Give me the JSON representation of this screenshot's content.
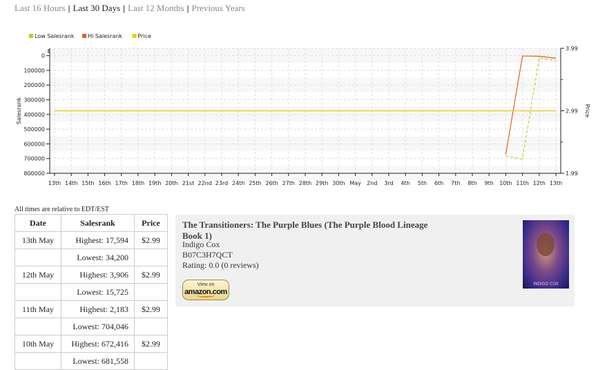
{
  "nav": {
    "items": [
      {
        "label": "Last 16 Hours",
        "active": false
      },
      {
        "label": "Last 30 Days",
        "active": true
      },
      {
        "label": "Last 12 Months",
        "active": false
      },
      {
        "label": "Previous Years",
        "active": false
      }
    ],
    "separator": "|"
  },
  "chart_data": {
    "type": "line",
    "legend_position": "top-left",
    "grid": true,
    "x_labels": [
      "13th",
      "14th",
      "15th",
      "16th",
      "17th",
      "18th",
      "19th",
      "20th",
      "21st",
      "22nd",
      "23rd",
      "24th",
      "25th",
      "26th",
      "27th",
      "28th",
      "29th",
      "30th",
      "May",
      "2nd",
      "3rd",
      "4th",
      "5th",
      "6th",
      "7th",
      "8th",
      "9th",
      "10th",
      "11th",
      "12th",
      "13th"
    ],
    "y_left": {
      "label": "Salesrank",
      "ticks": [
        0,
        100000,
        200000,
        300000,
        400000,
        500000,
        600000,
        700000,
        800000
      ],
      "tick_labels": [
        "0",
        "100000",
        "200000",
        "300000",
        "400000",
        "500000",
        "600000",
        "700000",
        "800000"
      ],
      "range": [
        800000,
        -50000
      ],
      "inverted": true
    },
    "y_right": {
      "label": "Price",
      "ticks": [
        1.99,
        2.99,
        3.99
      ],
      "tick_labels": [
        "1.99",
        "2.99",
        "3.99"
      ],
      "range": [
        1.99,
        3.99
      ]
    },
    "series": [
      {
        "name": "Low Salesrank",
        "axis": "left",
        "color": "#b8d020",
        "dashed": true,
        "points": [
          [
            27,
            681558
          ],
          [
            28,
            704046
          ],
          [
            29,
            15725
          ],
          [
            30,
            34200
          ]
        ]
      },
      {
        "name": "Hi Salesrank",
        "axis": "left",
        "color": "#e06020",
        "dashed": false,
        "points": [
          [
            27,
            672416
          ],
          [
            28,
            2183
          ],
          [
            29,
            3906
          ],
          [
            30,
            17594
          ]
        ]
      },
      {
        "name": "Price",
        "axis": "right",
        "color": "#e8d000",
        "dashed": false,
        "points": [
          [
            0,
            2.99
          ],
          [
            30,
            2.99
          ]
        ]
      }
    ]
  },
  "timezone_note": "All times are relative to EDT/EST",
  "table": {
    "headers": [
      "Date",
      "Salesrank",
      "Price"
    ],
    "rows": [
      {
        "date": "13th May",
        "rank": "Highest: 17,594",
        "price": "$2.99"
      },
      {
        "date": "",
        "rank": "Lowest: 34,200",
        "price": ""
      },
      {
        "date": "12th May",
        "rank": "Highest: 3,906",
        "price": "$2.99"
      },
      {
        "date": "",
        "rank": "Lowest: 15,725",
        "price": ""
      },
      {
        "date": "11th May",
        "rank": "Highest: 2,183",
        "price": "$2.99"
      },
      {
        "date": "",
        "rank": "Lowest: 704,046",
        "price": ""
      },
      {
        "date": "10th May",
        "rank": "Highest: 672,416",
        "price": "$2.99"
      },
      {
        "date": "",
        "rank": "Lowest: 681,558",
        "price": ""
      }
    ]
  },
  "book": {
    "title": "The Transitioners: The Purple Blues (The Purple Blood Lineage Book 1)",
    "author": "Indigo Cox",
    "asin": "B07C3H7QCT",
    "rating": "Rating: 0.0  (0 reviews)",
    "amazon_button": {
      "view_on": "View on",
      "brand": "amazon.com"
    },
    "cover_author_text": "INDIGO COX"
  }
}
